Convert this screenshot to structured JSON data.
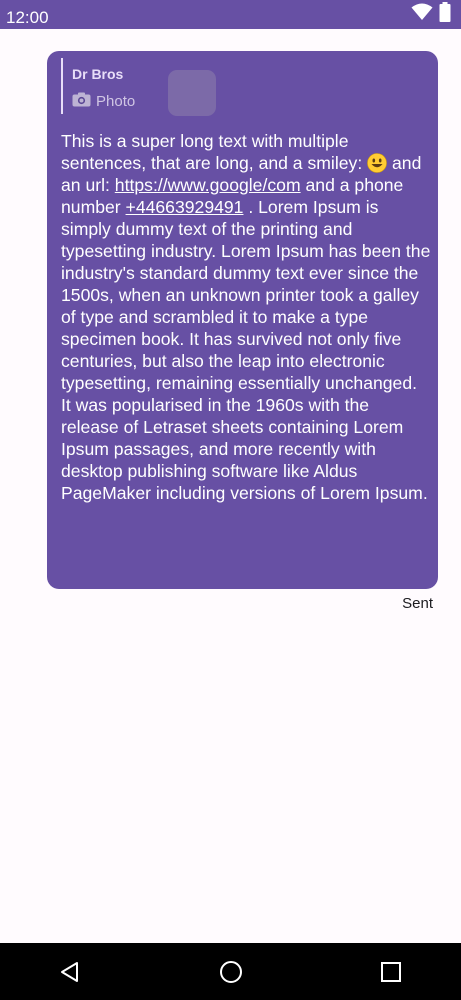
{
  "status_bar": {
    "time": "12:00",
    "icons": [
      "wifi-icon",
      "battery-icon"
    ]
  },
  "message": {
    "reply": {
      "sender": "Dr Bros",
      "preview_icon": "camera-icon",
      "preview_label": "Photo"
    },
    "text_before_emoji": "This is a super long text with multiple sentences, that are long, and a smiley: ",
    "emoji": "smiley-emoji",
    "text_before_url": " and an url: ",
    "url": "https://www.google/com",
    "text_before_phone": " and a phone number ",
    "phone": "+44663929491",
    "text_after_phone": " . Lorem Ipsum is simply dummy text of the printing and typesetting industry. Lorem Ipsum has been the industry's standard dummy text ever since the 1500s, when an unknown printer took a galley of type and scrambled it to make a type specimen book. It has survived not only five centuries, but also the leap into electronic typesetting, remaining essentially unchanged. It was popularised in the 1960s with the release of Letraset sheets containing Lorem Ipsum passages, and more recently with desktop publishing software like Aldus PageMaker including versions of Lorem Ipsum.",
    "status": "Sent"
  },
  "nav_bar": {
    "buttons": [
      "back-triangle-icon",
      "home-circle-icon",
      "recents-square-icon"
    ]
  },
  "colors": {
    "accent": "#6750a4",
    "background": "#fffbfe",
    "bubble_text": "#ffffff",
    "reply_text": "#e8def8",
    "emoji_face": "#ffcc33"
  }
}
